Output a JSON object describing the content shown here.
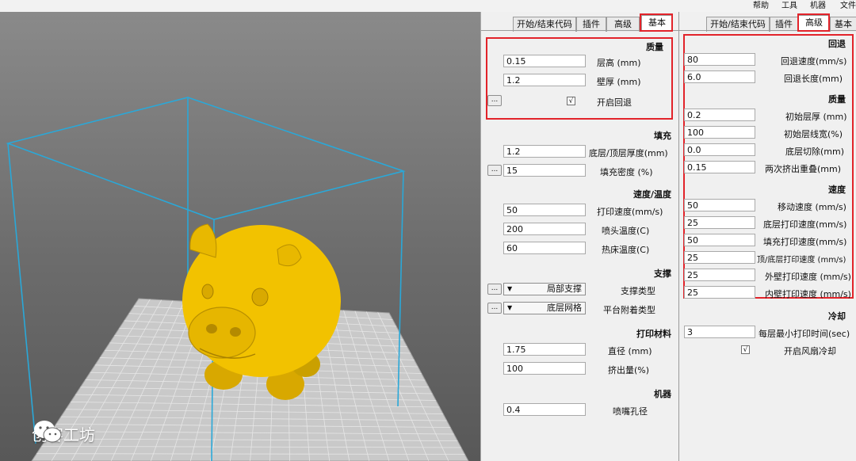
{
  "menu": {
    "file": "文件",
    "machine": "机器",
    "tools": "工具",
    "help": "帮助"
  },
  "watermark": {
    "text": "创客工坊"
  },
  "left_panel": {
    "tabs": [
      {
        "label": "开始/结束代码"
      },
      {
        "label": "插件"
      },
      {
        "label": "高级"
      },
      {
        "label": "基本"
      }
    ],
    "sections": {
      "quality": "质量",
      "fill": "填充",
      "speed_temp": "速度/温度",
      "support": "支撑",
      "filament": "打印材料",
      "machine": "机器"
    },
    "fields": {
      "layer_height": {
        "label": "层高 (mm)",
        "value": "0.15"
      },
      "shell_thickness": {
        "label": "壁厚 (mm)",
        "value": "1.2"
      },
      "enable_retraction": {
        "label": "开启回退",
        "checked": "√"
      },
      "bottom_top_thickness": {
        "label": "底层/顶层厚度(mm)",
        "value": "1.2"
      },
      "fill_density": {
        "label": "填充密度 (%)",
        "value": "15"
      },
      "print_speed": {
        "label": "打印速度(mm/s)",
        "value": "50"
      },
      "nozzle_temp": {
        "label": "喷头温度(C)",
        "value": "200"
      },
      "bed_temp": {
        "label": "热床温度(C)",
        "value": "60"
      },
      "support_type": {
        "label": "支撑类型",
        "value": "局部支撑"
      },
      "platform_adhesion": {
        "label": "平台附着类型",
        "value": "底层网格"
      },
      "diameter": {
        "label": "直径 (mm)",
        "value": "1.75"
      },
      "flow": {
        "label": "挤出量(%)",
        "value": "100"
      },
      "nozzle_size": {
        "label": "喷嘴孔径",
        "value": "0.4"
      }
    },
    "dots_label": "..."
  },
  "right_panel": {
    "tabs": [
      {
        "label": "开始/结束代码"
      },
      {
        "label": "插件"
      },
      {
        "label": "高级"
      },
      {
        "label": "基本"
      }
    ],
    "sections": {
      "retraction": "回退",
      "quality": "质量",
      "speed": "速度",
      "cool": "冷却"
    },
    "fields": {
      "retraction_speed": {
        "label": "回退速度(mm/s)",
        "value": "80"
      },
      "retraction_distance": {
        "label": "回退长度(mm)",
        "value": "6.0"
      },
      "initial_layer_thickness": {
        "label": "初始层厚 (mm)",
        "value": "0.2"
      },
      "initial_layer_line_width": {
        "label": "初始层线宽(%)",
        "value": "100"
      },
      "cut_off_object_bottom": {
        "label": "底层切除(mm)",
        "value": "0.0"
      },
      "dual_extrusion_overlap": {
        "label": "两次挤出重叠(mm)",
        "value": "0.15"
      },
      "travel_speed": {
        "label": "移动速度 (mm/s)",
        "value": "50"
      },
      "bottom_layer_speed": {
        "label": "底层打印速度(mm/s)",
        "value": "25"
      },
      "infill_speed": {
        "label": "填充打印速度(mm/s)",
        "value": "50"
      },
      "top_bottom_speed": {
        "label": "顶/底层打印速度 (mm/s)",
        "value": "25"
      },
      "outer_shell_speed": {
        "label": "外壁打印速度 (mm/s)",
        "value": "25"
      },
      "inner_shell_speed": {
        "label": "内壁打印速度 (mm/s)",
        "value": "25"
      },
      "min_layer_time": {
        "label": "每层最小打印时间(sec)",
        "value": "3"
      },
      "enable_cooling_fan": {
        "label": "开启风扇冷却",
        "checked": "√"
      }
    }
  },
  "colors": {
    "highlight": "#e2232a",
    "model": "#f2c200",
    "build_volume": "#2aa8d8"
  }
}
